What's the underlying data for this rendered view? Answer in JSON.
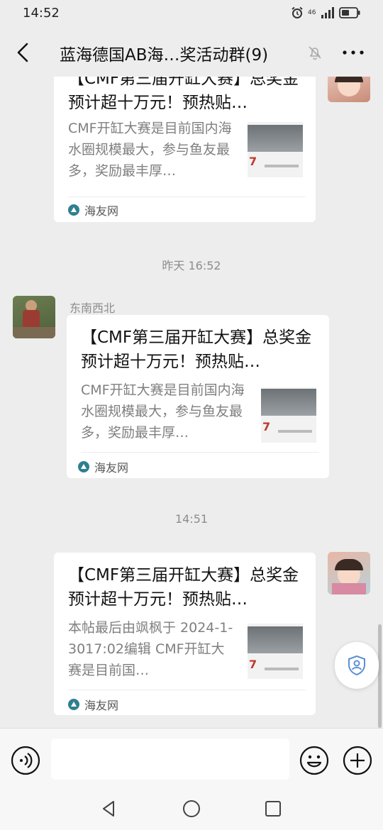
{
  "status_bar": {
    "time": "14:52",
    "network": "46",
    "icons": [
      "alarm-icon",
      "signal-icon",
      "battery-icon"
    ]
  },
  "header": {
    "title": "蓝海德国AB海…奖活动群(9)",
    "icons": [
      "back-icon",
      "mute-icon",
      "more-icon"
    ]
  },
  "messages": [
    {
      "direction": "outgoing",
      "title": "【CMF第三届开缸大赛】总奖金预计超十万元！预热贴…",
      "description": "CMF开缸大赛是目前国内海水圈规模最大，参与鱼友最多，奖励最丰厚…",
      "source": "海友网"
    },
    {
      "type": "time",
      "text": "昨天 16:52"
    },
    {
      "direction": "incoming",
      "sender": "东南西北",
      "title": "【CMF第三届开缸大赛】总奖金预计超十万元！预热贴…",
      "description": "CMF开缸大赛是目前国内海水圈规模最大，参与鱼友最多，奖励最丰厚…",
      "source": "海友网"
    },
    {
      "type": "time",
      "text": "14:51"
    },
    {
      "direction": "outgoing",
      "title": "【CMF第三届开缸大赛】总奖金预计超十万元！预热贴…",
      "description": "本帖最后由飒枫于 2024-1-3017:02编辑 CMF开缸大赛是目前国…",
      "source": "海友网"
    }
  ],
  "thumbnail": {
    "digit": "7"
  },
  "input": {
    "placeholder": "",
    "value": ""
  },
  "colors": {
    "background": "#ededed",
    "card": "#ffffff",
    "secondary_text": "#7f7f7f",
    "source_icon": "#2f7f8f"
  }
}
